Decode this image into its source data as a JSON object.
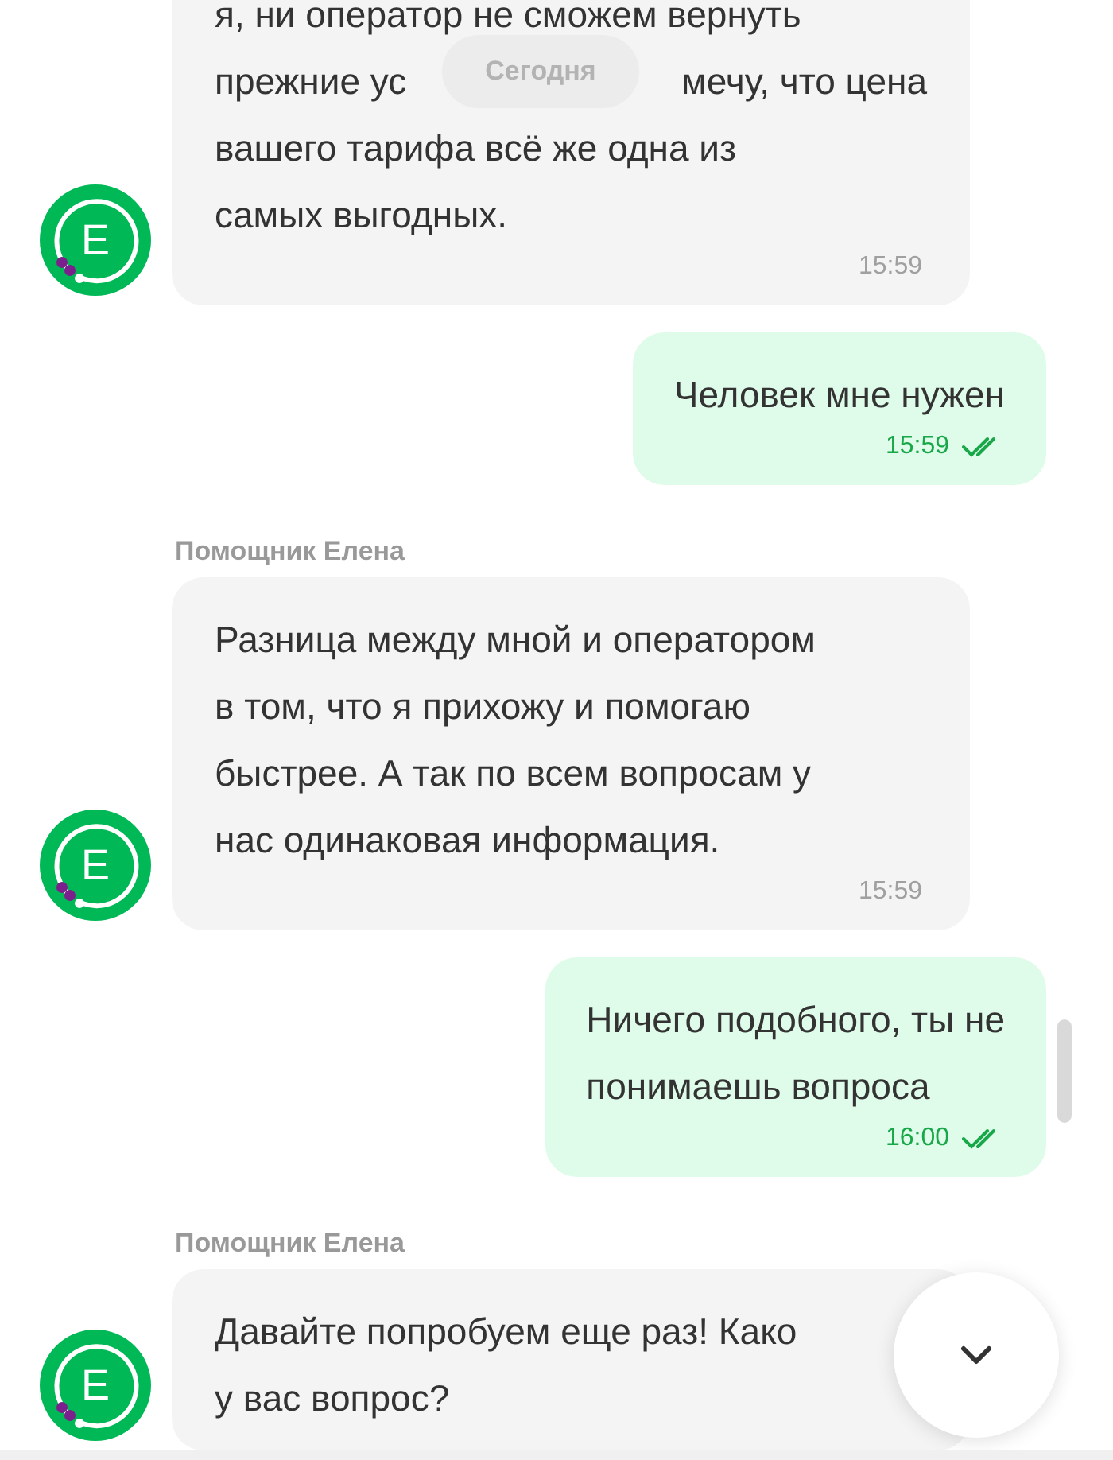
{
  "date_chip": "Сегодня",
  "messages": [
    {
      "kind": "incoming",
      "lines": [
        [
          "я, ни оператор не сможем вернуть"
        ],
        [
          "прежние ус",
          "мечу, что цена"
        ],
        [
          "вашего тарифа всё же одна из"
        ],
        [
          "самых выгодных."
        ]
      ],
      "time": "15:59",
      "avatar": "E"
    },
    {
      "kind": "outgoing",
      "text": "Человек мне нужен",
      "time": "15:59",
      "read": true
    },
    {
      "kind": "incoming",
      "sender": "Помощник Елена",
      "text": "Разница между мной и оператором\nв том, что я прихожу и помогаю\nбыстрее. А так по всем вопросам у\nнас одинаковая информация.",
      "time": "15:59",
      "avatar": "E"
    },
    {
      "kind": "outgoing",
      "text": "Ничего подобного, ты не\nпонимаешь вопроса",
      "time": "16:00",
      "read": true
    },
    {
      "kind": "incoming",
      "sender": "Помощник Елена",
      "text": "Давайте попробуем еще раз! Како\nу вас вопрос?",
      "avatar": "E"
    }
  ]
}
